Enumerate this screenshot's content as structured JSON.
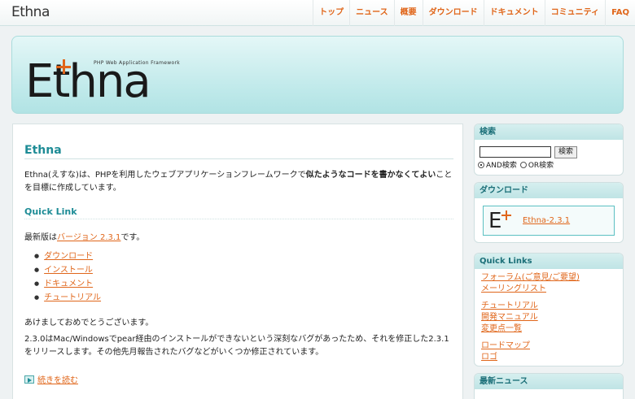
{
  "header": {
    "small_logo": "Ethna",
    "nav": [
      "トップ",
      "ニュース",
      "概要",
      "ダウンロード",
      "ドキュメント",
      "コミュニティ",
      "FAQ"
    ]
  },
  "banner": {
    "tagline": "PHP Web Application Framework",
    "logo": "Ethna"
  },
  "main": {
    "title": "Ethna",
    "intro_pre": "Ethna(えすな)は、PHPを利用したウェブアプリケーションフレームワークで",
    "intro_bold": "似たようなコードを書かなくてよい",
    "intro_post": "ことを目標に作成しています。",
    "quick_link_title": "Quick Link",
    "latest_pre": "最新版は",
    "latest_link": "バージョン 2.3.1",
    "latest_post": "です。",
    "links": [
      "ダウンロード",
      "インストール",
      "ドキュメント",
      "チュートリアル"
    ],
    "greeting": "あけましておめでとうございます。",
    "news": "2.3.0はMac/Windowsでpear経由のインストールができないという深刻なバグがあったため、それを修正した2.3.1をリリースします。その他先月報告されたバグなどがいくつか修正されています。",
    "read_more": "続きを読む"
  },
  "sidebar": {
    "search": {
      "title": "検索",
      "button": "検索",
      "value": "",
      "and_label": "AND検索",
      "or_label": "OR検索"
    },
    "download": {
      "title": "ダウンロード",
      "logo": "E",
      "link": "Ethna-2.3.1"
    },
    "quick_links": {
      "title": "Quick Links",
      "group1": [
        "フォーラム(ご意見/ご要望)",
        "メーリングリスト"
      ],
      "group2": [
        "チュートリアル",
        "開発マニュアル",
        "変更点一覧"
      ],
      "group3": [
        "ロードマップ",
        "ロゴ"
      ]
    },
    "news": {
      "title": "最新ニュース"
    }
  },
  "colors": {
    "accent": "#e0661a",
    "heading": "#1e8c96",
    "banner": "#bfe9ea"
  }
}
